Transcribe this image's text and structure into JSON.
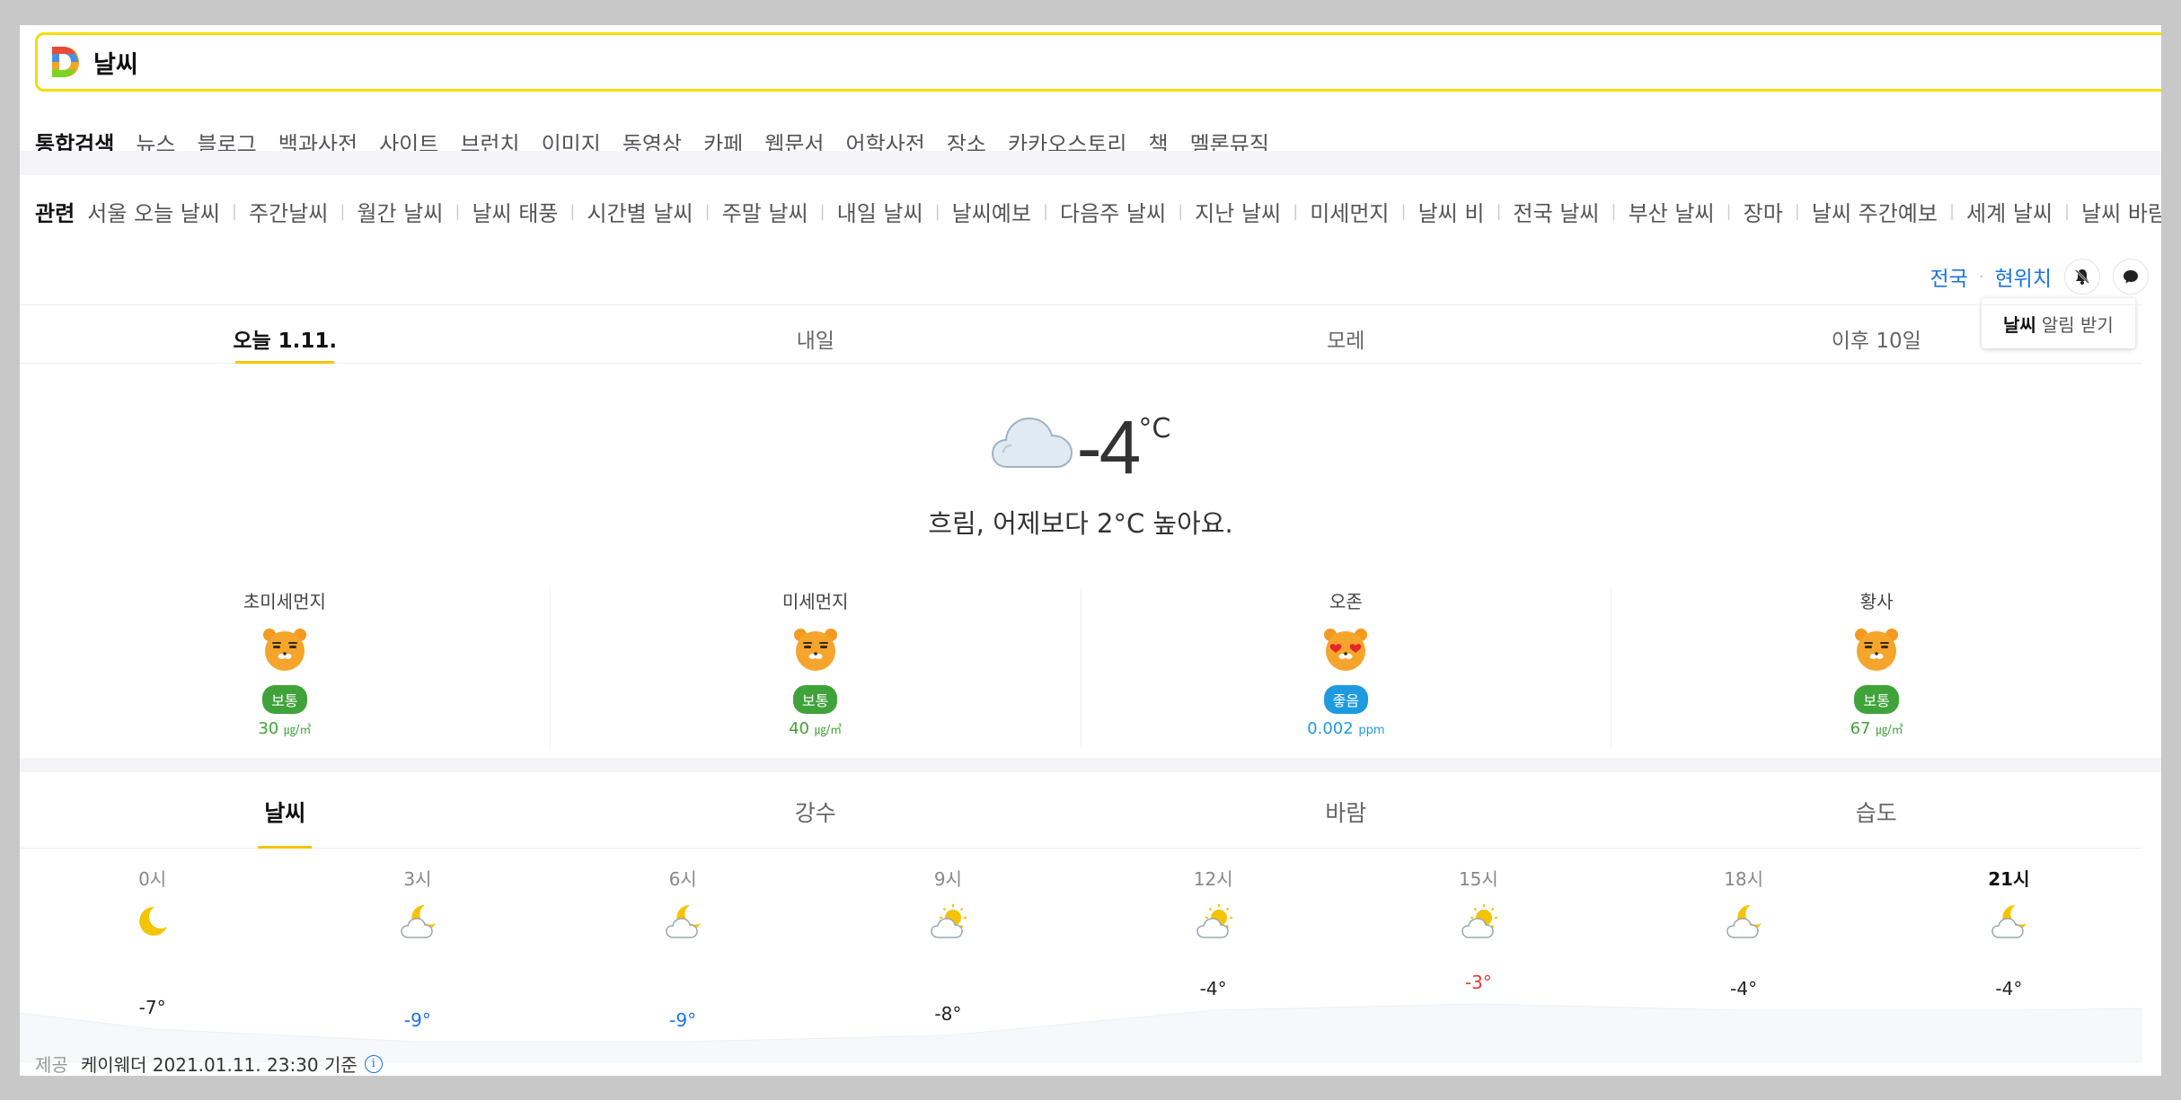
{
  "search": {
    "query": "날씨"
  },
  "colors": {
    "accent": "#f5c400",
    "link": "#1a73e8",
    "good": "#1e9be0",
    "normal": "#3fa33a",
    "warm": "#e53935"
  },
  "categories": [
    "통합검색",
    "뉴스",
    "블로그",
    "백과사전",
    "사이트",
    "브런치",
    "이미지",
    "동영상",
    "카페",
    "웹문서",
    "어학사전",
    "장소",
    "카카오스토리",
    "책",
    "멜론뮤직"
  ],
  "related": {
    "label": "관련",
    "keywords": [
      "서울 오늘 날씨",
      "주간날씨",
      "월간 날씨",
      "날씨 태풍",
      "시간별 날씨",
      "주말 날씨",
      "내일 날씨",
      "날씨예보",
      "다음주 날씨",
      "지난 날씨",
      "미세먼지",
      "날씨 비",
      "전국 날씨",
      "부산 날씨",
      "장마",
      "날씨 주간예보",
      "세계 날씨",
      "날씨 바람"
    ]
  },
  "location": {
    "nation": "전국",
    "current": "현위치"
  },
  "alarm_tooltip": {
    "bold": "날씨",
    "rest": "알림 받기"
  },
  "day_tabs": [
    "오늘 1.11.",
    "내일",
    "모레",
    "이후 10일"
  ],
  "current": {
    "icon": "cloud-icon",
    "temp": "-4",
    "unit": "°C",
    "description": "흐림, 어제보다 2°C 높아요."
  },
  "dust": [
    {
      "name": "초미세먼지",
      "face": "ryan-normal-face-icon",
      "status": "보통",
      "value": "30",
      "unit": "㎍/㎥"
    },
    {
      "name": "미세먼지",
      "face": "ryan-normal-face-icon",
      "status": "보통",
      "value": "40",
      "unit": "㎍/㎥"
    },
    {
      "name": "오존",
      "face": "ryan-heart-eyes-face-icon",
      "status": "좋음",
      "value": "0.002",
      "unit": "ppm"
    },
    {
      "name": "황사",
      "face": "ryan-normal-face-icon",
      "status": "보통",
      "value": "67",
      "unit": "㎍/㎥"
    }
  ],
  "bottom_tabs": [
    "날씨",
    "강수",
    "바람",
    "습도"
  ],
  "hourly": [
    {
      "time": "0시",
      "icon": "moon-icon",
      "temp": "-7°",
      "t": -7,
      "style": "normal"
    },
    {
      "time": "3시",
      "icon": "moon-cloud-icon",
      "temp": "-9°",
      "t": -9,
      "style": "cold"
    },
    {
      "time": "6시",
      "icon": "moon-cloud-icon",
      "temp": "-9°",
      "t": -9,
      "style": "cold"
    },
    {
      "time": "9시",
      "icon": "sun-cloud-icon",
      "temp": "-8°",
      "t": -8,
      "style": "normal"
    },
    {
      "time": "12시",
      "icon": "sun-cloud-icon",
      "temp": "-4°",
      "t": -4,
      "style": "normal"
    },
    {
      "time": "15시",
      "icon": "sun-cloud-icon",
      "temp": "-3°",
      "t": -3,
      "style": "warm"
    },
    {
      "time": "18시",
      "icon": "moon-cloud-icon",
      "temp": "-4°",
      "t": -4,
      "style": "normal"
    },
    {
      "time": "21시",
      "icon": "moon-cloud-icon",
      "temp": "-4°",
      "t": -4,
      "style": "normal",
      "now": true
    }
  ],
  "footer": {
    "provider_label": "제공",
    "provider": "케이웨더 2021.01.11. 23:30 기준"
  }
}
